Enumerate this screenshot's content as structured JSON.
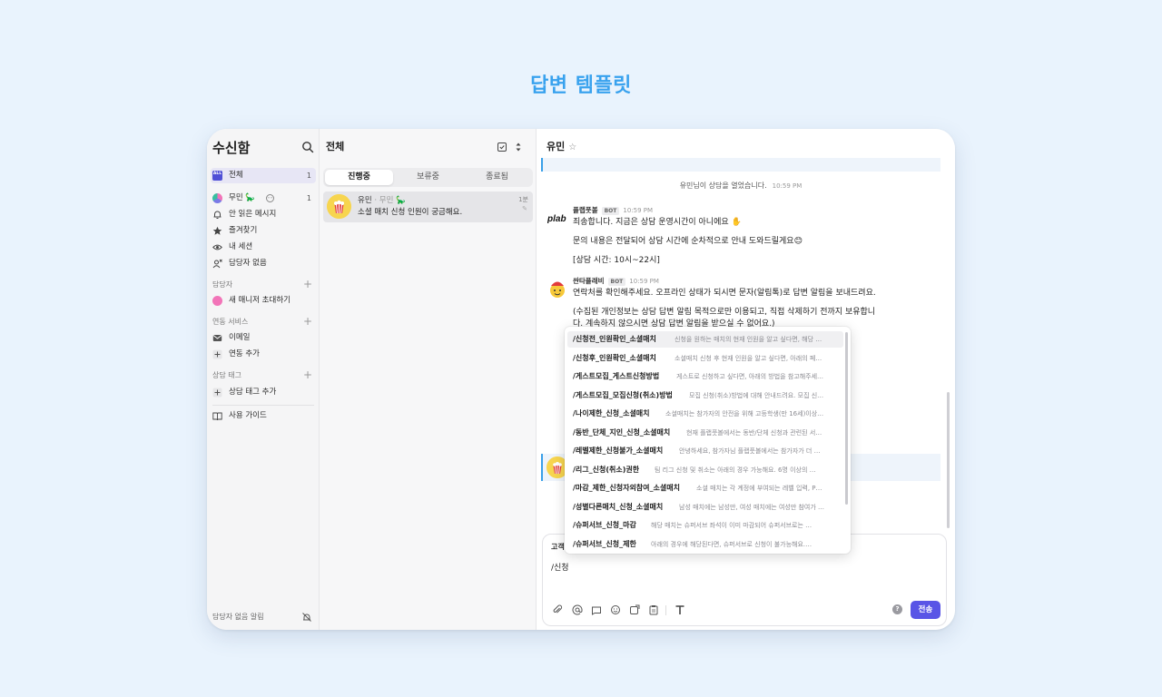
{
  "hero": {
    "title": "답변 템플릿"
  },
  "sidebar": {
    "title": "수신함",
    "all": {
      "badge": "ALL",
      "label": "전체",
      "count": "1"
    },
    "items": [
      {
        "label": "무민 🦕",
        "count": "1"
      },
      {
        "label": "안 읽은 메시지"
      },
      {
        "label": "즐겨찾기"
      },
      {
        "label": "내 세션"
      },
      {
        "label": "담당자 없음"
      }
    ],
    "sections": {
      "assignee": "담당자",
      "invite": "새 매니저 초대하기",
      "linked": "연동 서비스",
      "email": "이메일",
      "add_link": "연동 추가",
      "tags": "상담 태그",
      "add_tag": "상담 태그 추가",
      "guide": "사용 가이드"
    },
    "footer": "담당자 없음 알림"
  },
  "list": {
    "title": "전체",
    "tabs": [
      "진행중",
      "보류중",
      "종료됨"
    ],
    "conversation": {
      "name": "유민",
      "sub": "· 무민 🦕",
      "message": "소셜 매치 신청 인원이 궁금해요.",
      "time": "1분"
    }
  },
  "chat": {
    "title": "유민",
    "system": {
      "text": "유민님이 상담을 열었습니다.",
      "time": "10:59 PM"
    },
    "bot1": {
      "name": "플랩풋볼",
      "tag": "BOT",
      "time": "10:59 PM",
      "lines": [
        "죄송합니다. 지금은 상담 운영시간이 아니에요 ✋",
        "문의 내용은 전달되어 상담 시간에 순차적으로 안내 도와드릴게요😊",
        "[상담 시간: 10시~22시]"
      ]
    },
    "bot2": {
      "name": "싼타플래비",
      "tag": "BOT",
      "time": "10:59 PM",
      "lines": [
        "연락처를 확인해주세요. 오프라인 상태가 되시면 문자(알림톡)로 답변 알림을 보내드려요.",
        "(수집된 개인정보는 상담 답변 알림 목적으로만 이용되고, 직접 삭제하기 전까지 보유합니",
        "다. 계속하지 않으시면 상담 답변 알림을 받으실 수 없어요.)"
      ]
    },
    "composer": {
      "label": "고객",
      "typed": "/신청",
      "send": "전송"
    }
  },
  "dropdown": {
    "items": [
      {
        "key": "/신청전_인원확인_소셜매치",
        "desc": "신청을 원하는 매치의 현재 인원을 알고 싶다면, 해당 …"
      },
      {
        "key": "/신청후_인원확인_소셜매치",
        "desc": "소셜매치 신청 후 현재 인원을 알고 싶다면, 아래의 페…"
      },
      {
        "key": "/게스트모집_게스트신청방법",
        "desc": "게스트로 신청하고 싶다면, 아래의 방법을 참고해주세…"
      },
      {
        "key": "/게스트모집_모집신청(취소)방법",
        "desc": "모집 신청(취소)방법에 대해 안내드려요. 모집 신…"
      },
      {
        "key": "/나이제한_신청_소셜매치",
        "desc": "소셜매치는 참가자의 안전을 위해 고등학생(만 16세)이상…"
      },
      {
        "key": "/동반_단체_지인_신청_소셜매치",
        "desc": "현재 플랩풋볼에서는 동반/단체 신청과 관련된 서…"
      },
      {
        "key": "/레벨제한_신청불가_소셜매치",
        "desc": "안녕하세요, 참가자님 플랩풋볼에서는 참가자가 더 …"
      },
      {
        "key": "/리그_신청(취소)권한",
        "desc": "팀 리그 신청 및 취소는 아래의 경우 가능해요. 6명 이상의 팀…"
      },
      {
        "key": "/마감_제한_신청자외참여_소셜매치",
        "desc": "소셜 매치는 각 계정에 부여되는 레벨 입력, P…"
      },
      {
        "key": "/성별다른매치_신청_소셜매치",
        "desc": "남성 매치에는 남성만, 여성 매치에는 여성만 참여가 …"
      },
      {
        "key": "/슈퍼서브_신청_마감",
        "desc": "해당 매치는 슈퍼서브 좌석이 이미 마감되어 슈퍼서브로는 추…"
      },
      {
        "key": "/슈퍼서브_신청_제한",
        "desc": "아래의 경우에 해당된다면, 슈퍼서브로 신청이 불가능해요. • …"
      }
    ]
  }
}
